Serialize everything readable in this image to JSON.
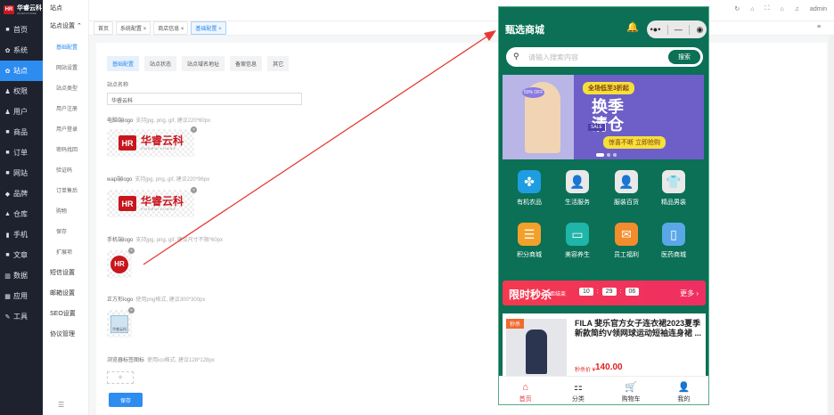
{
  "brand": {
    "name": "华睿云科",
    "sub": "HUARUIYUNKE",
    "badge": "HR"
  },
  "nav": [
    {
      "icon": "home-icon",
      "glyph": "■",
      "label": "首页"
    },
    {
      "icon": "gear-icon",
      "glyph": "✿",
      "label": "系统"
    },
    {
      "icon": "gear-icon",
      "glyph": "✿",
      "label": "站点",
      "active": true
    },
    {
      "icon": "user-icon",
      "glyph": "♟",
      "label": "权限"
    },
    {
      "icon": "user-icon",
      "glyph": "♟",
      "label": "用户"
    },
    {
      "icon": "bag-icon",
      "glyph": "■",
      "label": "商品"
    },
    {
      "icon": "order-icon",
      "glyph": "■",
      "label": "订单"
    },
    {
      "icon": "monitor-icon",
      "glyph": "■",
      "label": "网站"
    },
    {
      "icon": "brand-icon",
      "glyph": "◆",
      "label": "品牌"
    },
    {
      "icon": "warehouse-icon",
      "glyph": "▲",
      "label": "仓库"
    },
    {
      "icon": "phone-icon",
      "glyph": "▮",
      "label": "手机"
    },
    {
      "icon": "article-icon",
      "glyph": "■",
      "label": "文章"
    },
    {
      "icon": "chart-icon",
      "glyph": "▥",
      "label": "数据"
    },
    {
      "icon": "apps-icon",
      "glyph": "▦",
      "label": "应用"
    },
    {
      "icon": "wrench-icon",
      "glyph": "✎",
      "label": "工具"
    }
  ],
  "subnav": {
    "head": "站点",
    "group": "站点设置",
    "items": [
      "基础配置",
      "网站设置",
      "站点类型",
      "用户注册",
      "用户登录",
      "密码找回",
      "验证码",
      "订单售后",
      "购物",
      "保存",
      "扩展项"
    ],
    "plain": [
      "短信设置",
      "邮箱设置",
      "SEO设置",
      "协议管理"
    ],
    "fold": "☰"
  },
  "tabs": [
    {
      "label": "首页",
      "close": false
    },
    {
      "label": "系统配置",
      "close": true
    },
    {
      "label": "商店信息",
      "close": true
    },
    {
      "label": "基础配置",
      "close": true,
      "active": true
    }
  ],
  "topbar": {
    "user": "admin",
    "more": "≡"
  },
  "pills": [
    "基础配置",
    "站点状态",
    "站点域名地址",
    "备案信息",
    "其它"
  ],
  "form": {
    "site_name_label": "站点名称",
    "site_name_value": "华睿云科",
    "pc_logo_label": "电脑端logo",
    "pc_logo_hint": "支持jpg, png, gif, 建议220*60px",
    "wap_logo_label": "wap端logo",
    "wap_logo_hint": "支持jpg, png, gif, 建议220*96px",
    "mobile_logo_label": "手机端logo",
    "mobile_logo_hint": "支持jpg, png, gif, 建议尺寸不限*60px",
    "square_logo_label": "正方形logo",
    "square_logo_hint": "使用png格式, 建议300*300px",
    "favicon_label": "浏览器标签图标",
    "favicon_hint": "使用ico格式, 建议128*128px",
    "save": "保存",
    "remove": "×",
    "upload_plus": "+",
    "qr_caption": "华睿云科"
  },
  "phone": {
    "title": "甄选商城",
    "bell": "🔔",
    "capsule": {
      "dots": "•●•",
      "minus": "—",
      "target": "◉"
    },
    "search_placeholder": "请输入搜索内容",
    "search_btn": "搜索",
    "banner": {
      "top": "全场低至3折起",
      "big1": "换季",
      "big2": "清仓",
      "small": "惊喜不断 立即抢购",
      "off": "50% OFF",
      "sale": "SALE"
    },
    "grid": [
      {
        "label": "有机农品",
        "color": "#1e9de0",
        "glyph": "✤"
      },
      {
        "label": "生活服务",
        "color": "#e9e9e9",
        "glyph": "👤"
      },
      {
        "label": "服装百货",
        "color": "#e9e9e9",
        "glyph": "👤"
      },
      {
        "label": "精品男装",
        "color": "#e9e9e9",
        "glyph": "👕"
      },
      {
        "label": "积分商城",
        "color": "#f3a12b",
        "glyph": "☰"
      },
      {
        "label": "美容养生",
        "color": "#1fb5a8",
        "glyph": "▭"
      },
      {
        "label": "员工福利",
        "color": "#f28c2c",
        "glyph": "✉"
      },
      {
        "label": "医药商城",
        "color": "#5aa7e8",
        "glyph": "▯"
      }
    ],
    "flash": {
      "title": "限时秒杀",
      "ends": "距结束",
      "h": "10",
      "m": "29",
      "s": "06",
      "more": "更多 ›"
    },
    "product": {
      "tag": "秒杀",
      "name": "FILA 斐乐官方女子连衣裙2023夏季新款简约V领网球运动短袖连身裙 ...",
      "price": "140.00",
      "price_label": "秒杀价 ¥"
    },
    "tabbar": [
      {
        "label": "首页",
        "glyph": "⌂",
        "active": true
      },
      {
        "label": "分类",
        "glyph": "⚏"
      },
      {
        "label": "购物车",
        "glyph": "🛒"
      },
      {
        "label": "我的",
        "glyph": "👤"
      }
    ]
  },
  "colors": {
    "accent": "#2d8cf0",
    "sidebar": "#1d222e",
    "phone_bg": "#0b7055",
    "arrow": "#e53935"
  }
}
